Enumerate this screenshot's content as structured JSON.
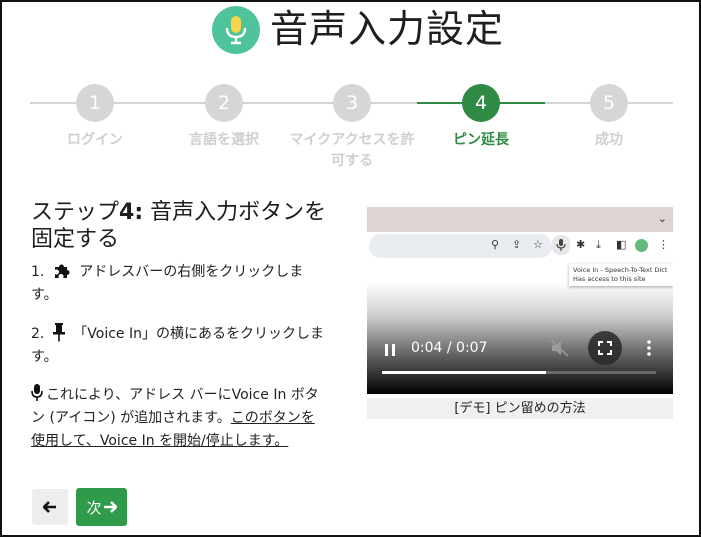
{
  "header": {
    "title": "音声入力設定",
    "logo_icon": "microphone-icon",
    "logo_color": "#4fc39a"
  },
  "stepper": {
    "active_color": "#2f8a44",
    "steps": [
      {
        "number": "1",
        "label": "ログイン",
        "state": "inactive"
      },
      {
        "number": "2",
        "label": "言語を選択",
        "state": "inactive"
      },
      {
        "number": "3",
        "label": "マイクアクセスを許",
        "label2": "可する",
        "state": "inactive"
      },
      {
        "number": "4",
        "label": "ピン延長",
        "state": "active"
      },
      {
        "number": "5",
        "label": "成功",
        "state": "inactive"
      }
    ]
  },
  "content": {
    "heading_prefix": "ステップ",
    "heading_number": "4:",
    "heading_rest": " 音声入力ボタンを",
    "heading_line2": "固定する",
    "instruction1": {
      "prefix": "1.",
      "icon": "puzzle-icon",
      "text": "アドレスバーの右側をクリックしま",
      "text2": "す。"
    },
    "instruction2": {
      "prefix": "2.",
      "icon": "pin-icon",
      "text": "「Voice In」の横にあるをクリックしま",
      "text2": "す。"
    },
    "instruction3": {
      "icon": "microphone-icon",
      "text": "これにより、アドレス バーにVoice In ボタ",
      "text2": "ン (アイコン) が追加されます。",
      "link": "このボタンを",
      "link2": "使用して、Voice In を開始/停止します。"
    }
  },
  "video": {
    "time": "0:04 / 0:07",
    "progress": 0.6,
    "tooltip_line1": "Voice In - Speech-To-Text Dict",
    "tooltip_line2": "Has access to this site",
    "caption": "[デモ] ピン留めの方法"
  },
  "nav": {
    "back_icon": "arrow-left-icon",
    "next_label": "次",
    "next_icon": "arrow-right-icon",
    "next_color": "#2f9a4a"
  }
}
